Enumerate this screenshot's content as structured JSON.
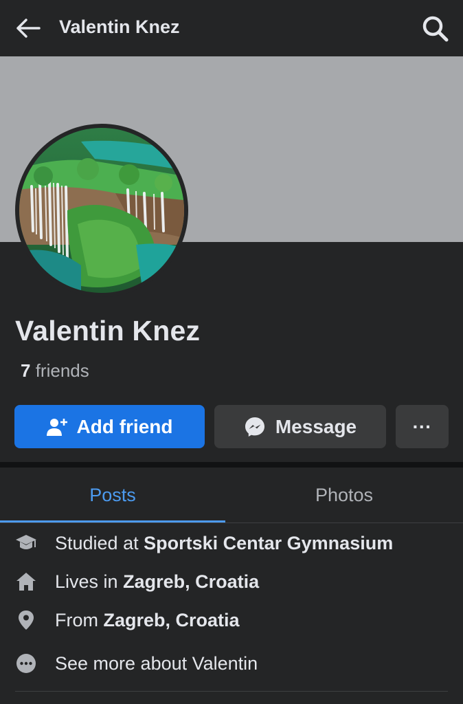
{
  "header": {
    "back_icon": "arrow-left-icon",
    "title": "Valentin Knez",
    "search_icon": "search-icon"
  },
  "profile": {
    "name": "Valentin Knez",
    "friends_count": "7",
    "friends_label": "friends",
    "cover_color": "#a7a9ac",
    "avatar_subject": "waterfall landscape photo"
  },
  "actions": {
    "add_friend_label": "Add friend",
    "add_friend_icon": "add-person-icon",
    "message_label": "Message",
    "message_icon": "messenger-icon",
    "more_label": "···",
    "accent_color": "#1b74e4"
  },
  "tabs": [
    {
      "label": "Posts",
      "active": true
    },
    {
      "label": "Photos",
      "active": false
    }
  ],
  "about": {
    "studied_prefix": "Studied at",
    "studied_value": "Sportski Centar Gymnasium",
    "lives_prefix": "Lives in",
    "lives_value": "Zagreb, Croatia",
    "from_prefix": "From",
    "from_value": "Zagreb, Croatia",
    "see_more": "See more about Valentin"
  }
}
